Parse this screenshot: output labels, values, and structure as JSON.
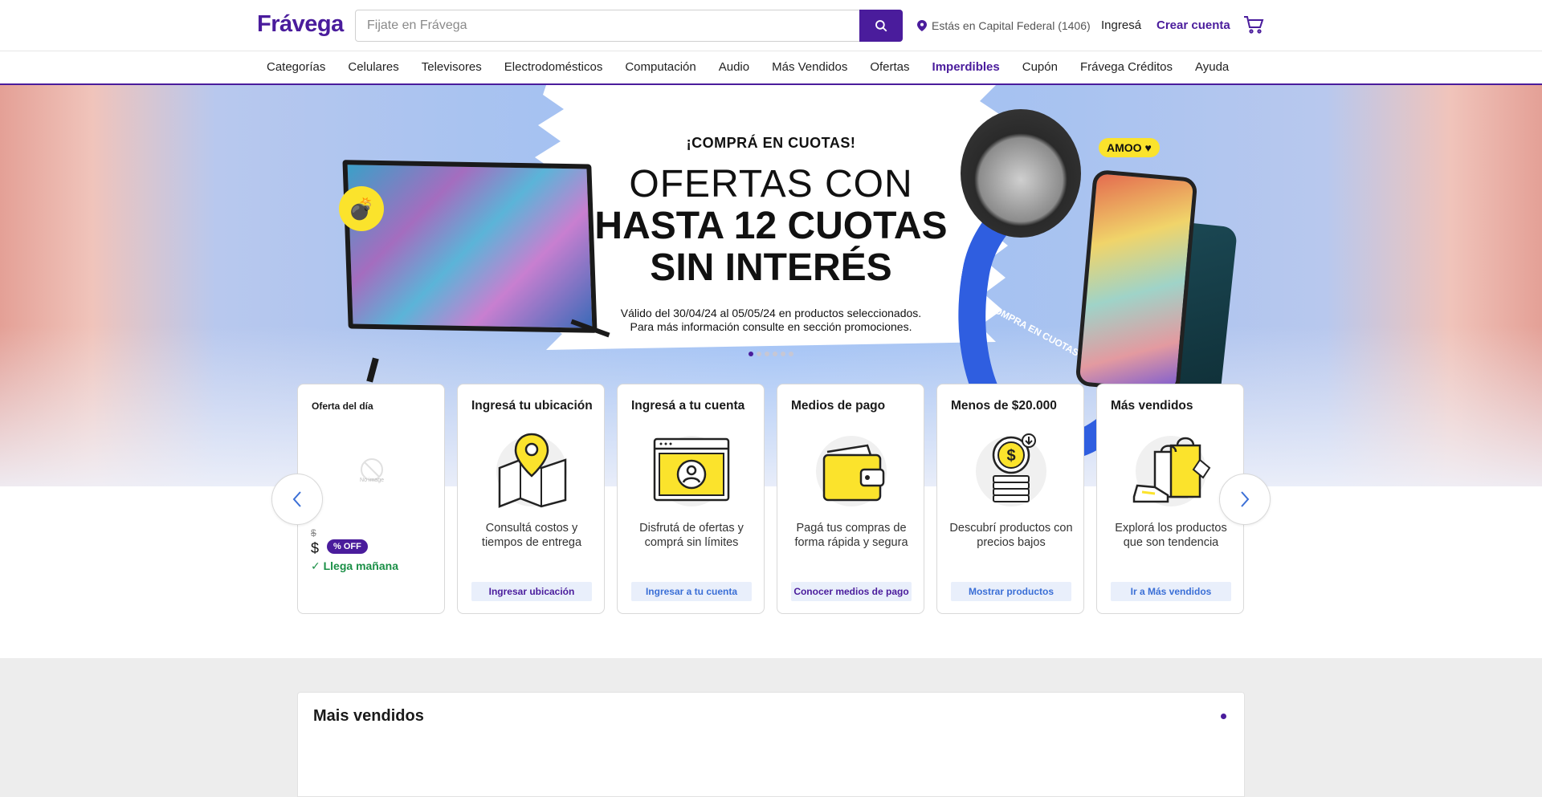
{
  "header": {
    "logo": "Frávega",
    "search_placeholder": "Fijate en Frávega",
    "location": "Estás en Capital Federal (1406)",
    "login": "Ingresá",
    "register": "Crear cuenta"
  },
  "nav": {
    "items": [
      "Categorías",
      "Celulares",
      "Televisores",
      "Electrodomésticos",
      "Computación",
      "Audio",
      "Más Vendidos",
      "Ofertas",
      "Imperdibles",
      "Cupón",
      "Frávega Créditos",
      "Ayuda"
    ],
    "highlighted": "Imperdibles"
  },
  "hero": {
    "kicker": "¡COMPRÁ EN CUOTAS!",
    "line1": "OFERTAS CON",
    "line2": "HASTA 12 CUOTAS",
    "line3": "SIN INTERÉS",
    "legal1": "Válido del 30/04/24 al 05/05/24 en productos seleccionados.",
    "legal2": "Para más información consulte en sección promociones.",
    "badge": "AMOO",
    "ribbon_text": "COMPRA EN CUOTAS · COMPRA EN CUOTAS",
    "slides": 6,
    "active_slide": 1
  },
  "deal_card": {
    "title": "Oferta del día",
    "no_image": "No image",
    "price_old": "$",
    "price": "$",
    "off": "% OFF",
    "shipping": "✓ Llega mañana"
  },
  "cards": [
    {
      "title": "Ingresá tu ubicación",
      "desc": "Consultá costos y tiempos de entrega",
      "button": "Ingresar ubicación",
      "icon": "map-pin-icon"
    },
    {
      "title": "Ingresá a tu cuenta",
      "desc": "Disfrutá de ofertas y comprá sin límites",
      "button": "Ingresar a tu cuenta",
      "icon": "user-window-icon"
    },
    {
      "title": "Medios de pago",
      "desc": "Pagá tus compras de forma rápida y segura",
      "button": "Conocer medios de pago",
      "icon": "wallet-icon"
    },
    {
      "title": "Menos de $20.000",
      "desc": "Descubrí productos con precios bajos",
      "button": "Mostrar productos",
      "icon": "coins-icon"
    },
    {
      "title": "Más vendidos",
      "desc": "Explorá los productos que son tendencia",
      "button": "Ir a Más vendidos",
      "icon": "shopping-bags-icon"
    }
  ],
  "best_sellers": {
    "title": "Mais vendidos"
  },
  "colors": {
    "brand": "#4a1c9c",
    "accent_yellow": "#fbe32c",
    "link_blue": "#3b6fd6",
    "success": "#1a8f46"
  }
}
